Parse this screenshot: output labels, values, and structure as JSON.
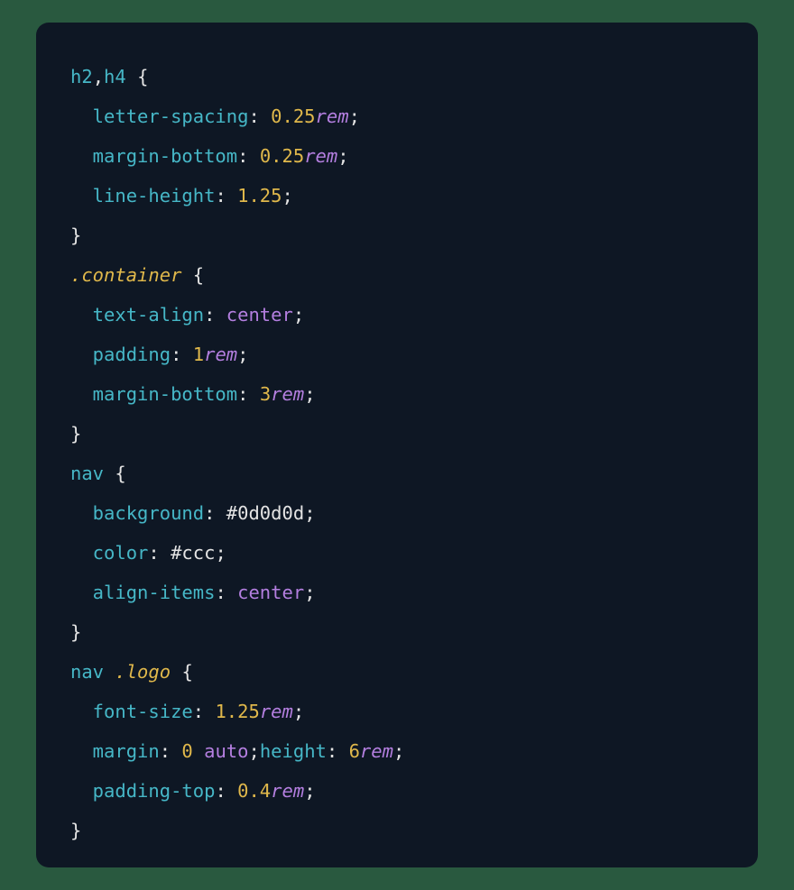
{
  "code": {
    "rules": [
      {
        "selector_parts": [
          {
            "text": "h2",
            "kind": "tag"
          },
          {
            "text": ",",
            "kind": "comma"
          },
          {
            "text": "h4",
            "kind": "tag"
          }
        ],
        "decls": [
          {
            "prop": "letter-spacing",
            "value": [
              {
                "text": "0.25",
                "kind": "num"
              },
              {
                "text": "rem",
                "kind": "unit"
              }
            ]
          },
          {
            "prop": "margin-bottom",
            "value": [
              {
                "text": "0.25",
                "kind": "num"
              },
              {
                "text": "rem",
                "kind": "unit"
              }
            ]
          },
          {
            "prop": "line-height",
            "value": [
              {
                "text": "1.25",
                "kind": "num"
              }
            ]
          }
        ]
      },
      {
        "selector_parts": [
          {
            "text": ".container",
            "kind": "class"
          }
        ],
        "decls": [
          {
            "prop": "text-align",
            "value": [
              {
                "text": "center",
                "kind": "kw"
              }
            ]
          },
          {
            "prop": "padding",
            "value": [
              {
                "text": "1",
                "kind": "num"
              },
              {
                "text": "rem",
                "kind": "unit"
              }
            ]
          },
          {
            "prop": "margin-bottom",
            "value": [
              {
                "text": "3",
                "kind": "num"
              },
              {
                "text": "rem",
                "kind": "unit"
              }
            ]
          }
        ]
      },
      {
        "selector_parts": [
          {
            "text": "nav",
            "kind": "tag"
          }
        ],
        "decls": [
          {
            "prop": "background",
            "value": [
              {
                "text": "#0d0d0d",
                "kind": "hex"
              }
            ]
          },
          {
            "prop": "color",
            "value": [
              {
                "text": "#ccc",
                "kind": "hex"
              }
            ]
          },
          {
            "prop": "align-items",
            "value": [
              {
                "text": "center",
                "kind": "kw"
              }
            ]
          }
        ]
      },
      {
        "selector_parts": [
          {
            "text": "nav",
            "kind": "tag"
          },
          {
            "text": " ",
            "kind": "sp"
          },
          {
            "text": ".logo",
            "kind": "class"
          }
        ],
        "decls": [
          {
            "prop": "font-size",
            "value": [
              {
                "text": "1.25",
                "kind": "num"
              },
              {
                "text": "rem",
                "kind": "unit"
              }
            ]
          },
          {
            "prop": "margin",
            "value": [
              {
                "text": "0",
                "kind": "num"
              },
              {
                "text": " ",
                "kind": "sp"
              },
              {
                "text": "auto",
                "kind": "kw"
              }
            ],
            "extra": {
              "prop": "height",
              "value": [
                {
                  "text": "6",
                  "kind": "num"
                },
                {
                  "text": "rem",
                  "kind": "unit"
                }
              ]
            }
          },
          {
            "prop": "padding-top",
            "value": [
              {
                "text": "0.4",
                "kind": "num"
              },
              {
                "text": "rem",
                "kind": "unit"
              }
            ]
          }
        ]
      }
    ]
  }
}
